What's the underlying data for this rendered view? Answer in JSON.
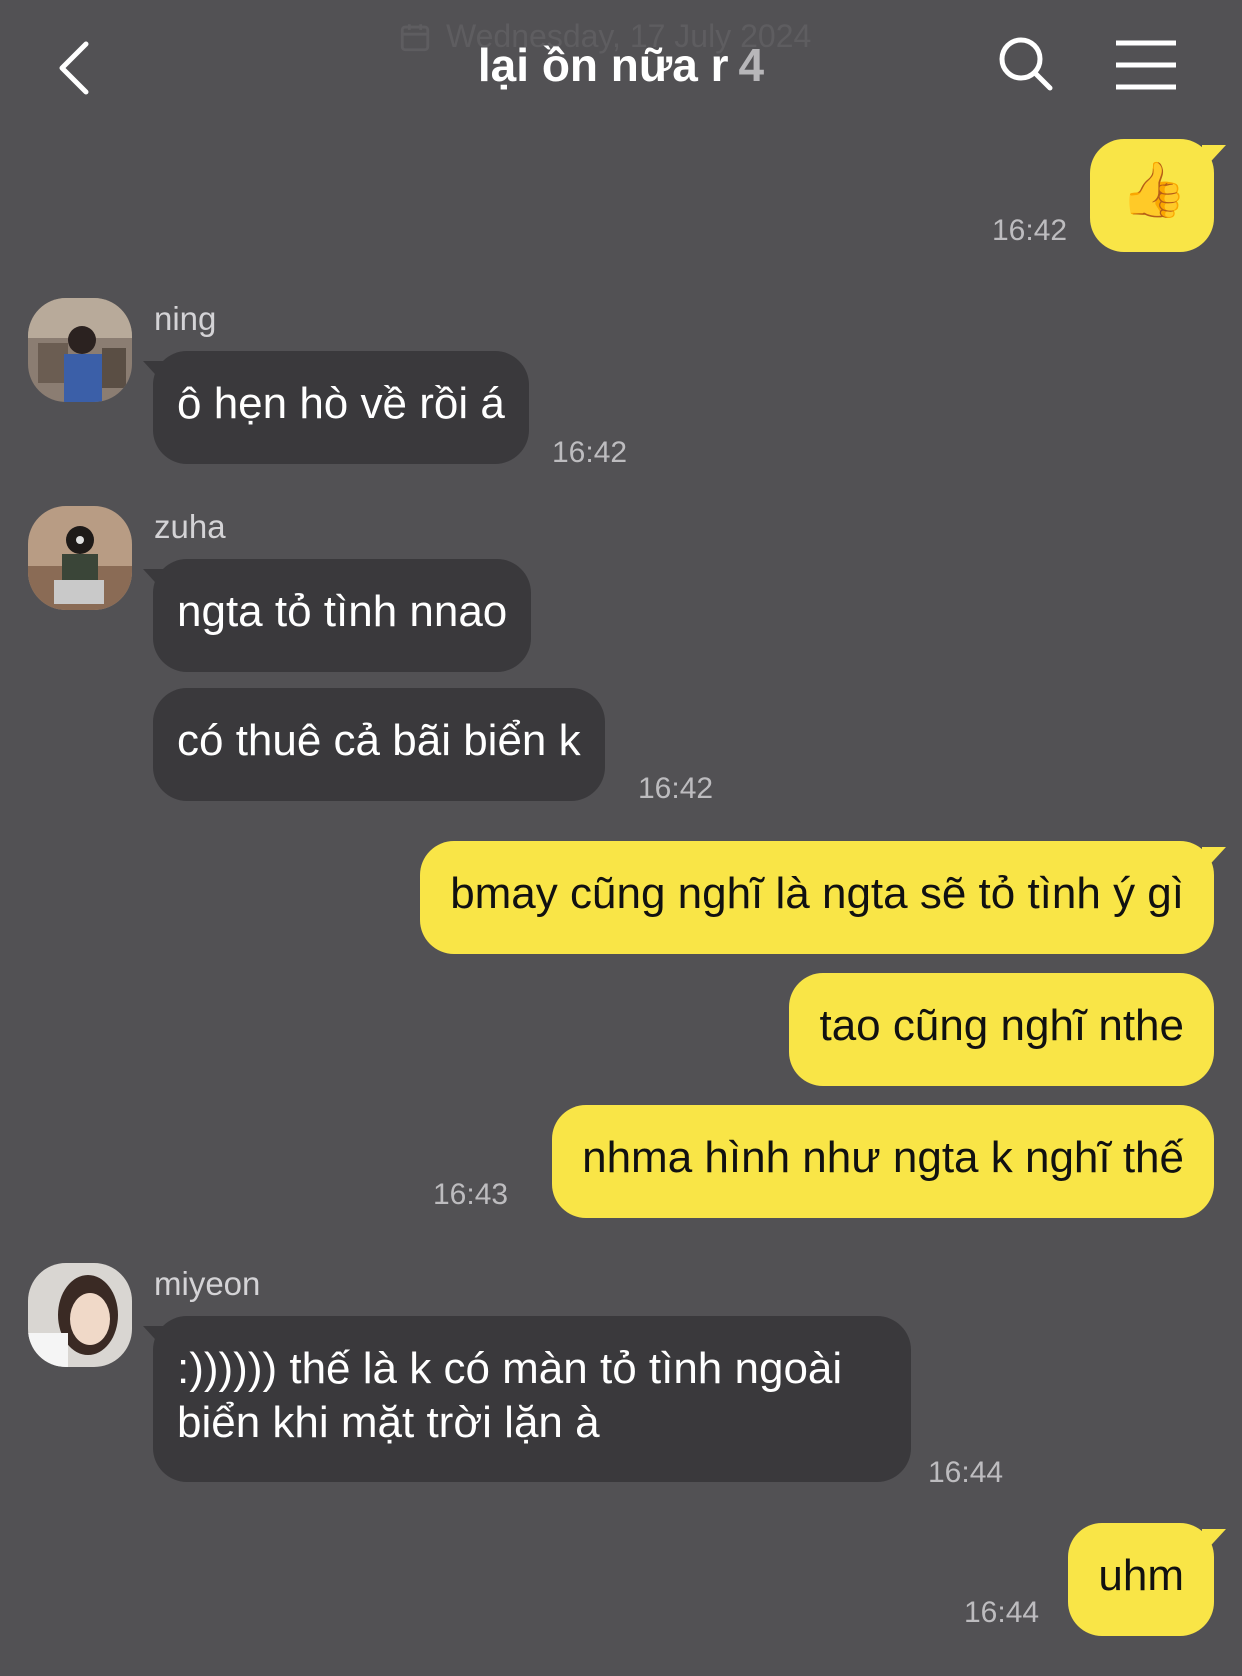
{
  "header": {
    "date_ghost": "Wednesday, 17 July 2024",
    "title": "lại ồn nữa r",
    "member_count": "4"
  },
  "messages": [
    {
      "type": "out",
      "emoji": "👍",
      "time": "16:42"
    },
    {
      "type": "in",
      "sender": "ning",
      "texts": [
        "ô hẹn hò về rồi á"
      ],
      "time": "16:42"
    },
    {
      "type": "in",
      "sender": "zuha",
      "texts": [
        "ngta tỏ tình nnao",
        "có thuê cả bãi biển k"
      ],
      "time": "16:42"
    },
    {
      "type": "out",
      "texts": [
        "bmay cũng nghĩ là ngta sẽ tỏ tình ý gì",
        "tao cũng nghĩ nthe",
        "nhma hình như ngta k nghĩ thế"
      ],
      "time": "16:43"
    },
    {
      "type": "in",
      "sender": "miyeon",
      "texts": [
        ":)))))) thế là k có màn tỏ tình ngoài biển khi mặt trời lặn à"
      ],
      "time": "16:44"
    },
    {
      "type": "out",
      "texts": [
        "uhm"
      ],
      "time": "16:44"
    }
  ],
  "colors": {
    "background": "#525154",
    "incoming_bubble": "#3a393c",
    "outgoing_bubble": "#f9e547"
  }
}
